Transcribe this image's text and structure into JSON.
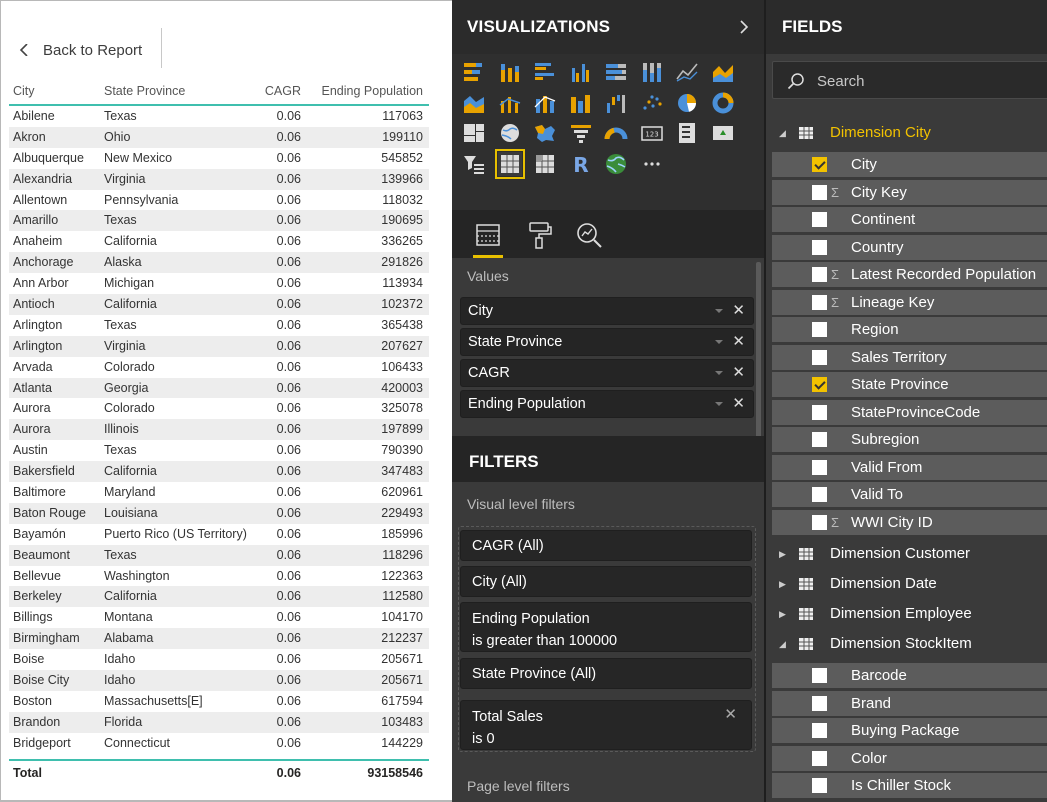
{
  "report": {
    "back_label": "Back to Report",
    "columns": {
      "city": "City",
      "state": "State Province",
      "cagr": "CAGR",
      "pop": "Ending Population"
    },
    "rows": [
      [
        "Abilene",
        "Texas",
        "0.06",
        "117063"
      ],
      [
        "Akron",
        "Ohio",
        "0.06",
        "199110"
      ],
      [
        "Albuquerque",
        "New Mexico",
        "0.06",
        "545852"
      ],
      [
        "Alexandria",
        "Virginia",
        "0.06",
        "139966"
      ],
      [
        "Allentown",
        "Pennsylvania",
        "0.06",
        "118032"
      ],
      [
        "Amarillo",
        "Texas",
        "0.06",
        "190695"
      ],
      [
        "Anaheim",
        "California",
        "0.06",
        "336265"
      ],
      [
        "Anchorage",
        "Alaska",
        "0.06",
        "291826"
      ],
      [
        "Ann Arbor",
        "Michigan",
        "0.06",
        "113934"
      ],
      [
        "Antioch",
        "California",
        "0.06",
        "102372"
      ],
      [
        "Arlington",
        "Texas",
        "0.06",
        "365438"
      ],
      [
        "Arlington",
        "Virginia",
        "0.06",
        "207627"
      ],
      [
        "Arvada",
        "Colorado",
        "0.06",
        "106433"
      ],
      [
        "Atlanta",
        "Georgia",
        "0.06",
        "420003"
      ],
      [
        "Aurora",
        "Colorado",
        "0.06",
        "325078"
      ],
      [
        "Aurora",
        "Illinois",
        "0.06",
        "197899"
      ],
      [
        "Austin",
        "Texas",
        "0.06",
        "790390"
      ],
      [
        "Bakersfield",
        "California",
        "0.06",
        "347483"
      ],
      [
        "Baltimore",
        "Maryland",
        "0.06",
        "620961"
      ],
      [
        "Baton Rouge",
        "Louisiana",
        "0.06",
        "229493"
      ],
      [
        "Bayamón",
        "Puerto Rico (US Territory)",
        "0.06",
        "185996"
      ],
      [
        "Beaumont",
        "Texas",
        "0.06",
        "118296"
      ],
      [
        "Bellevue",
        "Washington",
        "0.06",
        "122363"
      ],
      [
        "Berkeley",
        "California",
        "0.06",
        "112580"
      ],
      [
        "Billings",
        "Montana",
        "0.06",
        "104170"
      ],
      [
        "Birmingham",
        "Alabama",
        "0.06",
        "212237"
      ],
      [
        "Boise",
        "Idaho",
        "0.06",
        "205671"
      ],
      [
        "Boise City",
        "Idaho",
        "0.06",
        "205671"
      ],
      [
        "Boston",
        "Massachusetts[E]",
        "0.06",
        "617594"
      ],
      [
        "Brandon",
        "Florida",
        "0.06",
        "103483"
      ],
      [
        "Bridgeport",
        "Connecticut",
        "0.06",
        "144229"
      ]
    ],
    "total": {
      "label": "Total",
      "cagr": "0.06",
      "pop": "93158546"
    }
  },
  "visualizations": {
    "title": "VISUALIZATIONS",
    "icons": [
      "stacked-bar-icon",
      "stacked-column-icon",
      "clustered-bar-icon",
      "clustered-column-icon",
      "100-stacked-bar-icon",
      "100-stacked-column-icon",
      "line-chart-icon",
      "area-chart-icon",
      "stacked-area-icon",
      "line-clustered-column-icon",
      "line-stacked-column-icon",
      "ribbon-chart-icon",
      "waterfall-chart-icon",
      "scatter-chart-icon",
      "pie-chart-icon",
      "donut-chart-icon",
      "treemap-icon",
      "map-icon",
      "filled-map-icon",
      "funnel-icon",
      "gauge-icon",
      "card-icon",
      "multi-row-card-icon",
      "kpi-icon",
      "slicer-icon",
      "table-icon",
      "matrix-icon",
      "r-visual-icon",
      "globe-icon",
      "more-icon"
    ],
    "selected_icon": "table-icon",
    "tabs": [
      "fields-tab",
      "format-tab",
      "analytics-tab"
    ],
    "values_label": "Values",
    "wells": [
      "City",
      "State Province",
      "CAGR",
      "Ending Population"
    ],
    "filters_title": "FILTERS",
    "visual_filters_label": "Visual level filters",
    "filters": [
      {
        "line1": "CAGR  (All)"
      },
      {
        "line1": "City  (All)"
      },
      {
        "line1": "Ending Population",
        "line2": "is greater than 100000"
      },
      {
        "line1": "State Province  (All)"
      },
      {
        "line1": "Total Sales",
        "line2": "is 0"
      }
    ],
    "page_filters_label": "Page level filters",
    "accent": "#e8c000"
  },
  "fields": {
    "title": "FIELDS",
    "search_placeholder": "Search",
    "tables": [
      {
        "name": "Dimension City",
        "expanded": true,
        "highlight": true,
        "fields": [
          {
            "name": "City",
            "checked": true,
            "sigma": false
          },
          {
            "name": "City Key",
            "checked": false,
            "sigma": true
          },
          {
            "name": "Continent",
            "checked": false,
            "sigma": false
          },
          {
            "name": "Country",
            "checked": false,
            "sigma": false
          },
          {
            "name": "Latest Recorded Population",
            "checked": false,
            "sigma": true
          },
          {
            "name": "Lineage Key",
            "checked": false,
            "sigma": true
          },
          {
            "name": "Region",
            "checked": false,
            "sigma": false
          },
          {
            "name": "Sales Territory",
            "checked": false,
            "sigma": false
          },
          {
            "name": "State Province",
            "checked": true,
            "sigma": false
          },
          {
            "name": "StateProvinceCode",
            "checked": false,
            "sigma": false
          },
          {
            "name": "Subregion",
            "checked": false,
            "sigma": false
          },
          {
            "name": "Valid From",
            "checked": false,
            "sigma": false
          },
          {
            "name": "Valid To",
            "checked": false,
            "sigma": false
          },
          {
            "name": "WWI City ID",
            "checked": false,
            "sigma": true
          }
        ]
      },
      {
        "name": "Dimension Customer",
        "expanded": false,
        "highlight": false,
        "fields": []
      },
      {
        "name": "Dimension Date",
        "expanded": false,
        "highlight": false,
        "fields": []
      },
      {
        "name": "Dimension Employee",
        "expanded": false,
        "highlight": false,
        "fields": []
      },
      {
        "name": "Dimension StockItem",
        "expanded": true,
        "highlight": false,
        "fields": [
          {
            "name": "Barcode",
            "checked": false,
            "sigma": false
          },
          {
            "name": "Brand",
            "checked": false,
            "sigma": false
          },
          {
            "name": "Buying Package",
            "checked": false,
            "sigma": false
          },
          {
            "name": "Color",
            "checked": false,
            "sigma": false
          },
          {
            "name": "Is Chiller Stock",
            "checked": false,
            "sigma": false
          }
        ]
      }
    ],
    "accent": "#f2c200"
  }
}
